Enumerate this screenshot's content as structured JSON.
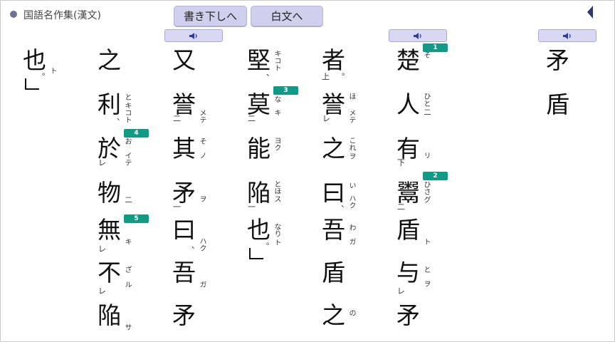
{
  "header": {
    "title": "国語名作集(漢文)",
    "btn_kakikudashi": "書き下しへ",
    "btn_hakubun": "白文へ"
  },
  "colors": {
    "badge": "#139a86",
    "button": "#cfcfee",
    "audio": "#d8d8f5",
    "dot": "#6f6f98"
  },
  "icons": {
    "audio": "speaker-icon",
    "back": "back-triangle-icon"
  },
  "text": {
    "title": [
      "矛",
      "盾"
    ],
    "col1": {
      "c": [
        "楚",
        "人",
        "有",
        "鬻",
        "盾",
        "与",
        "矛"
      ],
      "f": [
        "そ",
        "ひと",
        "",
        "ひさ",
        "",
        "と",
        ""
      ],
      "k": [
        "",
        "二",
        "リ",
        "グ",
        "ト",
        "ヲ",
        ""
      ],
      "kaeri": [
        "",
        "",
        "下",
        "二",
        "",
        "レ",
        ""
      ]
    },
    "col2": {
      "c": [
        "者",
        "誉",
        "之",
        "曰",
        "吾",
        "盾",
        "之"
      ],
      "f": [
        "",
        "ほ",
        "これ",
        "い",
        "わ",
        "",
        "の"
      ],
      "k": [
        "",
        "メテ",
        "ヲ",
        "ハク",
        "ガ",
        "",
        ""
      ],
      "kaeri": [
        "上",
        "レ",
        "",
        "",
        "",
        "",
        ""
      ],
      "mk": [
        "。",
        "",
        "",
        "、",
        "",
        "",
        ""
      ]
    },
    "col3": {
      "c": [
        "堅",
        "莫",
        "能",
        "陥",
        "也"
      ],
      "f": [
        "",
        "な",
        "",
        "とほ",
        "なり"
      ],
      "k": [
        "キコト",
        "キ",
        "ヨク",
        "ス",
        "ト"
      ],
      "kaeri": [
        "",
        "二",
        "",
        "一",
        ""
      ],
      "mk": [
        "、",
        "",
        "",
        "",
        "。"
      ]
    },
    "col4": {
      "c": [
        "又",
        "誉",
        "其",
        "矛",
        "曰",
        "吾",
        "矛"
      ],
      "f": [
        "",
        "",
        "そ",
        "",
        "",
        "",
        ""
      ],
      "k": [
        "",
        "メテ",
        "ノ",
        "ヲ",
        "ハク",
        "ガ",
        ""
      ],
      "kaeri": [
        "",
        "二",
        "",
        "一",
        "",
        "",
        ""
      ],
      "mk": [
        "",
        "",
        "",
        "",
        "、",
        "",
        ""
      ]
    },
    "col5": {
      "c": [
        "之",
        "利",
        "於",
        "物",
        "無",
        "不",
        "陥"
      ],
      "f": [
        "",
        "と",
        "お",
        "",
        "",
        "ざ",
        ""
      ],
      "k": [
        "",
        "キコト",
        "イテ",
        "二",
        "キ",
        "ル",
        "サ"
      ],
      "kaeri": [
        "",
        "",
        "レ",
        "",
        "レ",
        "レ",
        ""
      ],
      "mk": [
        "",
        "、",
        "",
        "",
        "",
        "",
        ""
      ]
    },
    "col6": {
      "c": [
        "也"
      ],
      "f": [
        ""
      ],
      "k": [
        "ト"
      ],
      "mk": [
        "。"
      ]
    }
  },
  "badges": [
    "1",
    "2",
    "3",
    "4",
    "5"
  ]
}
